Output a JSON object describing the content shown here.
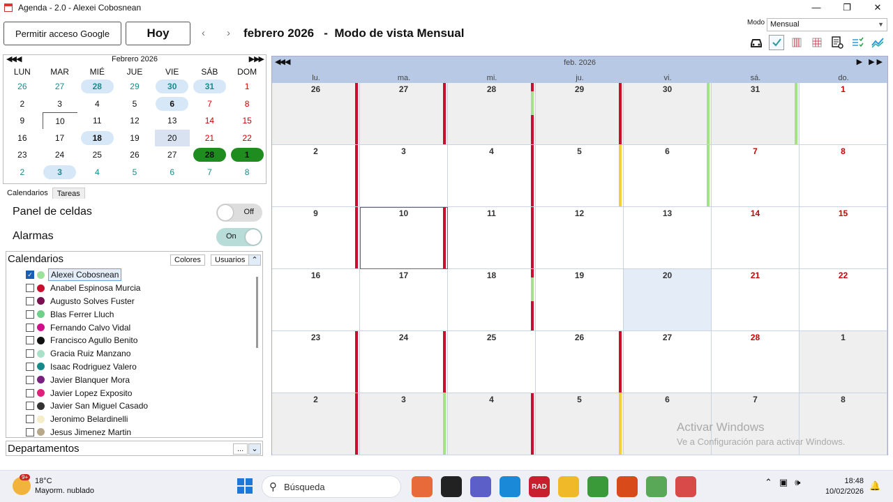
{
  "window": {
    "title": "Agenda  - 2.0 - Alexei Cobosnean",
    "controls": [
      "—",
      "❐",
      "✕"
    ]
  },
  "toolbar": {
    "google_button": "Permitir acceso Google",
    "today_button": "Hoy",
    "prev": "‹",
    "next": "›",
    "period_title": "febrero 2026   -  Modo de vista Mensual",
    "mode_label": "Modo",
    "mode_value": "Mensual",
    "view_icons": [
      "car-icon",
      "checklist-icon",
      "week-grid-icon",
      "day-grid-icon",
      "settings-table-icon",
      "task-list-icon",
      "chart-line-icon"
    ]
  },
  "mini_calendar": {
    "title": "Febrero 2026",
    "nav_prev": "◀◀ ◀",
    "nav_next": "▶ ▶▶",
    "weekdays": [
      "LUN",
      "MAR",
      "MIÉ",
      "JUE",
      "VIE",
      "SÁB",
      "DOM"
    ],
    "days": [
      {
        "d": "26",
        "t": "other"
      },
      {
        "d": "27",
        "t": "other"
      },
      {
        "d": "28",
        "t": "other bold"
      },
      {
        "d": "29",
        "t": "other"
      },
      {
        "d": "30",
        "t": "other bold"
      },
      {
        "d": "31",
        "t": "other bold"
      },
      {
        "d": "1",
        "t": "we"
      },
      {
        "d": "2",
        "t": ""
      },
      {
        "d": "3",
        "t": ""
      },
      {
        "d": "4",
        "t": ""
      },
      {
        "d": "5",
        "t": ""
      },
      {
        "d": "6",
        "t": "bold"
      },
      {
        "d": "7",
        "t": "we"
      },
      {
        "d": "8",
        "t": "we"
      },
      {
        "d": "9",
        "t": ""
      },
      {
        "d": "10",
        "t": "today"
      },
      {
        "d": "11",
        "t": ""
      },
      {
        "d": "12",
        "t": ""
      },
      {
        "d": "13",
        "t": ""
      },
      {
        "d": "14",
        "t": "we"
      },
      {
        "d": "15",
        "t": "we"
      },
      {
        "d": "16",
        "t": ""
      },
      {
        "d": "17",
        "t": ""
      },
      {
        "d": "18",
        "t": "bold"
      },
      {
        "d": "19",
        "t": ""
      },
      {
        "d": "20",
        "t": "sel"
      },
      {
        "d": "21",
        "t": "we"
      },
      {
        "d": "22",
        "t": "we"
      },
      {
        "d": "23",
        "t": ""
      },
      {
        "d": "24",
        "t": ""
      },
      {
        "d": "25",
        "t": ""
      },
      {
        "d": "26",
        "t": ""
      },
      {
        "d": "27",
        "t": ""
      },
      {
        "d": "28",
        "t": "green"
      },
      {
        "d": "1",
        "t": "green"
      },
      {
        "d": "2",
        "t": "other"
      },
      {
        "d": "3",
        "t": "other bold"
      },
      {
        "d": "4",
        "t": "other"
      },
      {
        "d": "5",
        "t": "other"
      },
      {
        "d": "6",
        "t": "other"
      },
      {
        "d": "7",
        "t": "other"
      },
      {
        "d": "8",
        "t": "other"
      }
    ]
  },
  "tabs": [
    "Calendarios",
    "Tareas"
  ],
  "panel_celdas": {
    "label": "Panel de celdas",
    "state": "Off"
  },
  "alarmas": {
    "label": "Alarmas",
    "state": "On"
  },
  "calendarios": {
    "title": "Calendarios",
    "colores_button": "Colores",
    "usuarios_button": "Usuarios",
    "collapse_icon": "⌃",
    "users": [
      {
        "name": "Alexei Cobosnean",
        "color": "#9be39b",
        "checked": true
      },
      {
        "name": "Anabel Espinosa Murcia",
        "color": "#c8102e",
        "checked": false
      },
      {
        "name": "Augusto Solves Fuster",
        "color": "#7a1050",
        "checked": false
      },
      {
        "name": "Blas Ferrer Lluch",
        "color": "#6fd08a",
        "checked": false
      },
      {
        "name": "Fernando Calvo Vidal",
        "color": "#d0108a",
        "checked": false
      },
      {
        "name": "Francisco Agullo Benito",
        "color": "#111111",
        "checked": false
      },
      {
        "name": "Gracia Ruiz Manzano",
        "color": "#a8e0c8",
        "checked": false
      },
      {
        "name": "Isaac Rodriguez Valero",
        "color": "#158a8a",
        "checked": false
      },
      {
        "name": "Javier Blanquer Mora",
        "color": "#7a2080",
        "checked": false
      },
      {
        "name": "Javier Lopez Exposito",
        "color": "#e0207a",
        "checked": false
      },
      {
        "name": "Javier San Miguel Casado",
        "color": "#333333",
        "checked": false
      },
      {
        "name": "Jeronimo Belardinelli",
        "color": "#f5ecc8",
        "checked": false
      },
      {
        "name": "Jesus Jimenez Martin",
        "color": "#b8a88a",
        "checked": false
      }
    ]
  },
  "departamentos": {
    "title": "Departamentos",
    "dots": "...",
    "expand_icon": "⌄"
  },
  "month_view": {
    "title": "feb. 2026",
    "prev": "◀◀ ◀",
    "next": "▶ ▶▶",
    "weekdays": [
      "lu.",
      "ma.",
      "mi.",
      "ju.",
      "vi.",
      "sá.",
      "do."
    ],
    "days": [
      {
        "d": "26",
        "t": "grey",
        "bars": [
          "red"
        ]
      },
      {
        "d": "27",
        "t": "grey",
        "bars": [
          "red"
        ]
      },
      {
        "d": "28",
        "t": "grey",
        "bars": [
          "red-green"
        ]
      },
      {
        "d": "29",
        "t": "grey",
        "bars": [
          "red"
        ]
      },
      {
        "d": "30",
        "t": "grey",
        "bars": [
          "green"
        ]
      },
      {
        "d": "31",
        "t": "grey",
        "bars": [
          "green"
        ]
      },
      {
        "d": "1",
        "t": "we",
        "bars": []
      },
      {
        "d": "2",
        "t": "",
        "bars": [
          "red"
        ]
      },
      {
        "d": "3",
        "t": "",
        "bars": []
      },
      {
        "d": "4",
        "t": "",
        "bars": [
          "red"
        ]
      },
      {
        "d": "5",
        "t": "",
        "bars": [
          "yellow"
        ]
      },
      {
        "d": "6",
        "t": "",
        "bars": [
          "green"
        ]
      },
      {
        "d": "7",
        "t": "we",
        "bars": []
      },
      {
        "d": "8",
        "t": "we",
        "bars": []
      },
      {
        "d": "9",
        "t": "",
        "bars": [
          "red"
        ]
      },
      {
        "d": "10",
        "t": "today",
        "bars": [
          "red"
        ]
      },
      {
        "d": "11",
        "t": "",
        "bars": [
          "red"
        ]
      },
      {
        "d": "12",
        "t": "",
        "bars": []
      },
      {
        "d": "13",
        "t": "",
        "bars": []
      },
      {
        "d": "14",
        "t": "we",
        "bars": []
      },
      {
        "d": "15",
        "t": "we",
        "bars": []
      },
      {
        "d": "16",
        "t": "",
        "bars": []
      },
      {
        "d": "17",
        "t": "",
        "bars": []
      },
      {
        "d": "18",
        "t": "",
        "bars": [
          "red-green"
        ]
      },
      {
        "d": "19",
        "t": "",
        "bars": []
      },
      {
        "d": "20",
        "t": "hl",
        "bars": []
      },
      {
        "d": "21",
        "t": "we",
        "bars": []
      },
      {
        "d": "22",
        "t": "we",
        "bars": []
      },
      {
        "d": "23",
        "t": "",
        "bars": [
          "red"
        ]
      },
      {
        "d": "24",
        "t": "",
        "bars": [
          "red"
        ]
      },
      {
        "d": "25",
        "t": "",
        "bars": []
      },
      {
        "d": "26",
        "t": "",
        "bars": [
          "red"
        ]
      },
      {
        "d": "27",
        "t": "",
        "bars": []
      },
      {
        "d": "28",
        "t": "we",
        "bars": []
      },
      {
        "d": "1",
        "t": "grey",
        "bars": []
      },
      {
        "d": "2",
        "t": "grey",
        "bars": [
          "red"
        ]
      },
      {
        "d": "3",
        "t": "grey",
        "bars": [
          "green"
        ]
      },
      {
        "d": "4",
        "t": "grey",
        "bars": [
          "red"
        ]
      },
      {
        "d": "5",
        "t": "grey",
        "bars": [
          "yellow"
        ]
      },
      {
        "d": "6",
        "t": "grey",
        "bars": []
      },
      {
        "d": "7",
        "t": "grey",
        "bars": []
      },
      {
        "d": "8",
        "t": "grey",
        "bars": []
      }
    ]
  },
  "watermark": {
    "line1": "Activar Windows",
    "line2": "Ve a Configuración para activar Windows."
  },
  "taskbar": {
    "weather_temp": "18°C",
    "weather_desc": "Mayorm. nublado",
    "weather_badge": "9+",
    "search_placeholder": "Búsqueda",
    "apps": [
      {
        "name": "gift-app-icon",
        "color": "#e86a3a",
        "label": ""
      },
      {
        "name": "terminal-app-icon",
        "color": "#222222",
        "label": ""
      },
      {
        "name": "teams-app-icon",
        "color": "#5b5fc7",
        "label": ""
      },
      {
        "name": "edge-app-icon",
        "color": "#1a8ad8",
        "label": ""
      },
      {
        "name": "rad-app-icon",
        "color": "#c81e2e",
        "label": "RAD"
      },
      {
        "name": "folder-app-icon",
        "color": "#f0b92a",
        "label": ""
      },
      {
        "name": "notepad-app-icon",
        "color": "#3a9a3a",
        "label": ""
      },
      {
        "name": "player-app-icon",
        "color": "#d84a1a",
        "label": ""
      },
      {
        "name": "network-app-icon",
        "color": "#58a858",
        "label": ""
      },
      {
        "name": "agenda-app-icon",
        "color": "#d84a4a",
        "label": ""
      }
    ],
    "time": "18:48",
    "date": "10/02/2026"
  },
  "colors": {
    "red": "#c8102e",
    "green": "#a8e08a",
    "yellow": "#f0d040",
    "accent": "#b7c9e4"
  }
}
